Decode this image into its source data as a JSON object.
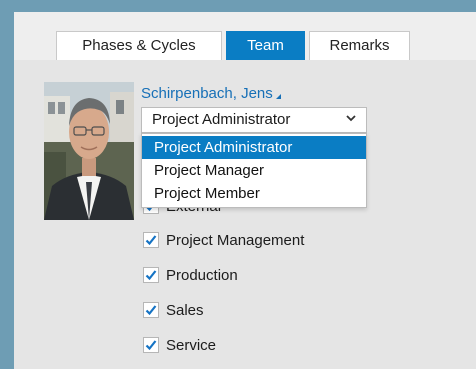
{
  "tabs": [
    {
      "label": "Phases & Cycles"
    },
    {
      "label": "Team"
    },
    {
      "label": "Remarks"
    }
  ],
  "active_tab": "Team",
  "colors": {
    "accent": "#0a7dc4",
    "link": "#1770b7",
    "frame": "#6e9db4"
  },
  "member": {
    "name": "Schirpenbach, Jens",
    "role_selected": "Project Administrator",
    "role_options": [
      {
        "label": "Project Administrator"
      },
      {
        "label": "Project Manager"
      },
      {
        "label": "Project Member"
      }
    ]
  },
  "departments": [
    {
      "label": "External",
      "checked": true
    },
    {
      "label": "Project Management",
      "checked": true
    },
    {
      "label": "Production",
      "checked": true
    },
    {
      "label": "Sales",
      "checked": true
    },
    {
      "label": "Service",
      "checked": true
    }
  ]
}
